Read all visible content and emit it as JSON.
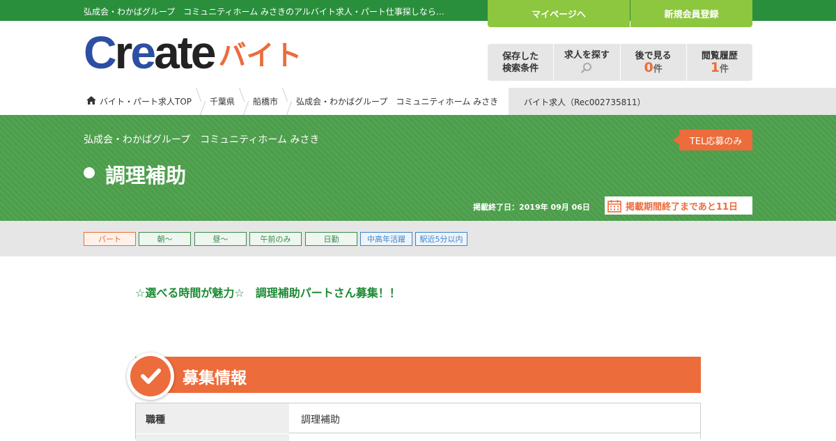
{
  "header": {
    "tagline": "弘成会・わかばグループ　コミュニティホーム みさきのアルバイト求人・パート仕事探しなら…",
    "mypage_label": "マイページへ",
    "register_label": "新規会員登録"
  },
  "logo": {
    "word_part1": "C",
    "word_part2": "r",
    "word_part3": "e",
    "word_part4": "ate",
    "sub": "バイト"
  },
  "tools": {
    "saved_search_line1": "保存した",
    "saved_search_line2": "検索条件",
    "find_jobs": "求人を探す",
    "watch_later": "後で見る",
    "watch_later_count": "0",
    "history": "閲覧履歴",
    "history_count": "1",
    "unit": "件"
  },
  "breadcrumb": {
    "items": [
      "バイト・パート求人TOP",
      "千葉県",
      "船橋市",
      "弘成会・わかばグループ　コミュニティホーム みさき"
    ],
    "current": "バイト求人（Rec002735811）"
  },
  "job": {
    "company": "弘成会・わかばグループ　コミュニティホーム みさき",
    "title": "調理補助",
    "tel_badge": "TEL応募のみ",
    "end_date": "掲載終了日：2019年 09月 06日",
    "remaining": "掲載期間終了まであと11日"
  },
  "tags": [
    {
      "label": "パート",
      "style": "orange"
    },
    {
      "label": "朝～",
      "style": "green"
    },
    {
      "label": "昼～",
      "style": "green"
    },
    {
      "label": "午前のみ",
      "style": "green"
    },
    {
      "label": "日勤",
      "style": "green"
    },
    {
      "label": "中高年活躍",
      "style": "blue"
    },
    {
      "label": "駅近5分以内",
      "style": "blue"
    }
  ],
  "catch_copy": "☆選べる時間が魅力☆　調理補助パートさん募集！！",
  "section": {
    "title": "募集情報",
    "rows": [
      {
        "label": "職種",
        "value": "調理補助"
      }
    ]
  },
  "colors": {
    "brand_green": "#2a8f3c",
    "accent_orange": "#ec6c3b",
    "light_green": "#8dc63f",
    "logo_blue": "#2d4fa3"
  }
}
